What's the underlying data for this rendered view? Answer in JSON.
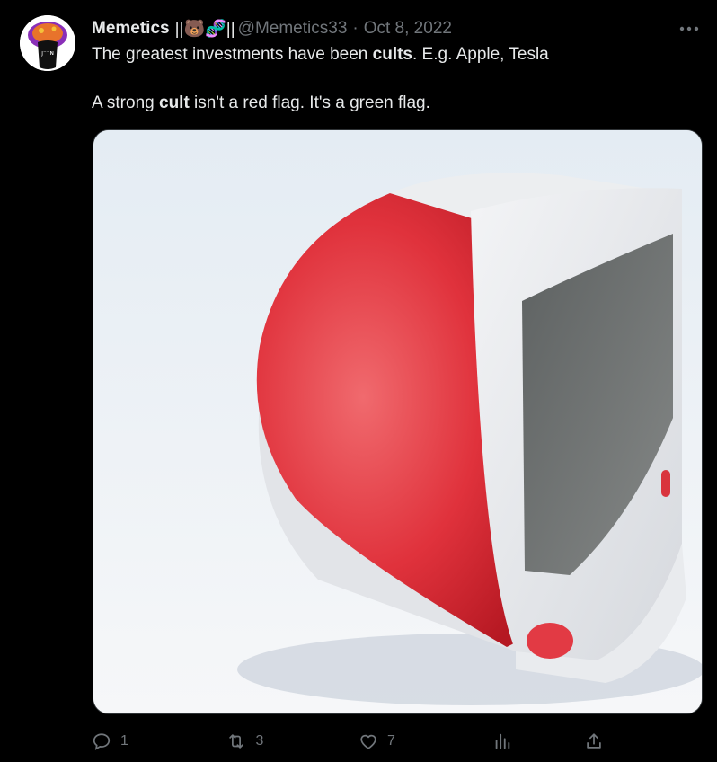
{
  "tweet": {
    "author_name": "Memetics",
    "badge_emojis": "||🐻🧬||",
    "handle": "@Memetics33",
    "separator": "·",
    "date": "Oct 8, 2022",
    "line1": {
      "before": "The greatest investments have been ",
      "bold": "cults",
      "after": ". E.g. Apple, Tesla"
    },
    "line2": {
      "before": "A strong ",
      "bold": "cult",
      "after": " isn't a red flag. It's a green flag."
    },
    "media_subject": "photo of a red and white iMac G3 on white background"
  },
  "actions": {
    "reply_count": "1",
    "retweet_count": "3",
    "like_count": "7"
  },
  "icons": {
    "more": "more-icon",
    "reply": "reply-icon",
    "retweet": "retweet-icon",
    "like": "like-icon",
    "analytics": "analytics-icon",
    "share": "share-icon"
  },
  "colors": {
    "background": "#000000",
    "text_primary": "#e7e9ea",
    "text_secondary": "#71767b",
    "imac_red": "#e0323c"
  }
}
